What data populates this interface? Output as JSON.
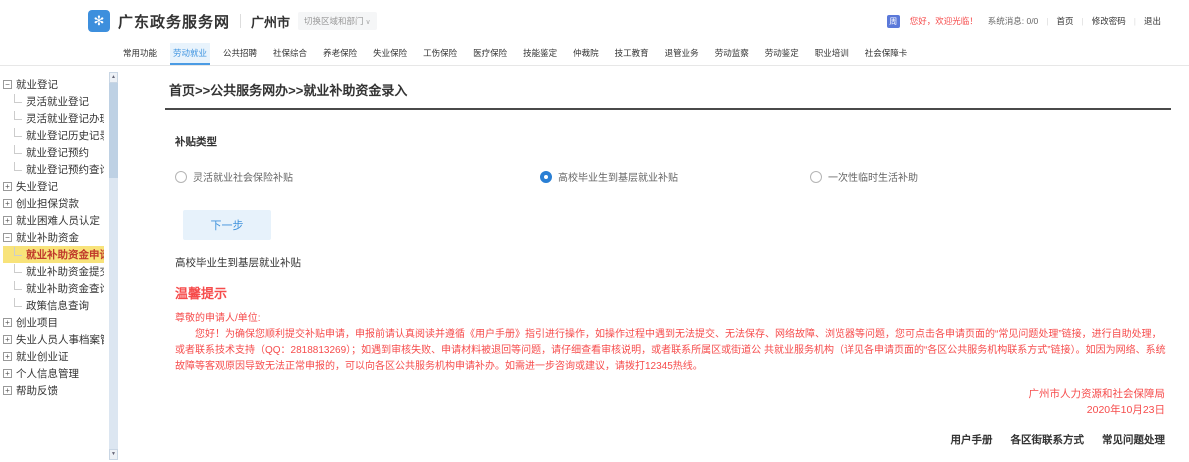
{
  "colors": {
    "accent_blue": "#3f94e0",
    "warning_red": "#f64c4c",
    "highlight_yellow": "#f8e37a",
    "selected_item_red": "#c0392b"
  },
  "header": {
    "site_title": "广东政务服务网",
    "city": "广州市",
    "region_switch": "切换区域和部门",
    "user_badge": "周",
    "welcome": "您好，欢迎光临！",
    "system_message": "系统消息: 0/0",
    "links": [
      "首页",
      "修改密码",
      "退出"
    ]
  },
  "nav": {
    "items": [
      {
        "label": "常用功能",
        "active": false
      },
      {
        "label": "劳动就业",
        "active": true
      },
      {
        "label": "公共招聘",
        "active": false
      },
      {
        "label": "社保综合",
        "active": false
      },
      {
        "label": "养老保险",
        "active": false
      },
      {
        "label": "失业保险",
        "active": false
      },
      {
        "label": "工伤保险",
        "active": false
      },
      {
        "label": "医疗保险",
        "active": false
      },
      {
        "label": "技能鉴定",
        "active": false
      },
      {
        "label": "仲裁院",
        "active": false
      },
      {
        "label": "技工教育",
        "active": false
      },
      {
        "label": "退管业务",
        "active": false
      },
      {
        "label": "劳动监察",
        "active": false
      },
      {
        "label": "劳动鉴定",
        "active": false
      },
      {
        "label": "职业培训",
        "active": false
      },
      {
        "label": "社会保障卡",
        "active": false
      }
    ]
  },
  "sidebar": {
    "items": [
      {
        "label": "就业登记",
        "level": 0,
        "expand": "minus",
        "selected": false
      },
      {
        "label": "灵活就业登记",
        "level": 1,
        "selected": false
      },
      {
        "label": "灵活就业登记办理结果",
        "level": 1,
        "selected": false
      },
      {
        "label": "就业登记历史记录",
        "level": 1,
        "selected": false
      },
      {
        "label": "就业登记预约",
        "level": 1,
        "selected": false
      },
      {
        "label": "就业登记预约查询",
        "level": 1,
        "selected": false
      },
      {
        "label": "失业登记",
        "level": 0,
        "expand": "plus",
        "selected": false
      },
      {
        "label": "创业担保贷款",
        "level": 0,
        "expand": "plus",
        "selected": false
      },
      {
        "label": "就业困难人员认定",
        "level": 0,
        "expand": "plus",
        "selected": false
      },
      {
        "label": "就业补助资金",
        "level": 0,
        "expand": "minus",
        "selected": false
      },
      {
        "label": "就业补助资金申请",
        "level": 1,
        "selected": true
      },
      {
        "label": "就业补助资金提交",
        "level": 1,
        "selected": false
      },
      {
        "label": "就业补助资金查询",
        "level": 1,
        "selected": false
      },
      {
        "label": "政策信息查询",
        "level": 1,
        "selected": false
      },
      {
        "label": "创业项目",
        "level": 0,
        "expand": "plus",
        "selected": false
      },
      {
        "label": "失业人员人事档案管理",
        "level": 0,
        "expand": "plus",
        "selected": false
      },
      {
        "label": "就业创业证",
        "level": 0,
        "expand": "plus",
        "selected": false
      },
      {
        "label": "个人信息管理",
        "level": 0,
        "expand": "plus",
        "selected": false
      },
      {
        "label": "帮助反馈",
        "level": 0,
        "expand": "plus",
        "selected": false
      }
    ]
  },
  "main": {
    "breadcrumb": "首页>>公共服务网办>>就业补助资金录入",
    "subsidy_type_label": "补贴类型",
    "radios": [
      {
        "label": "灵活就业社会保险补贴",
        "checked": false
      },
      {
        "label": "高校毕业生到基层就业补贴",
        "checked": true
      },
      {
        "label": "一次性临时生活补助",
        "checked": false
      }
    ],
    "next_button": "下一步",
    "selected_subsidy": "高校毕业生到基层就业补贴",
    "notice": {
      "title": "温馨提示",
      "salutation": "尊敬的申请人/单位:",
      "body": "您好！为确保您顺利提交补贴申请，申报前请认真阅读并遵循《用户手册》指引进行操作，如操作过程中遇到无法提交、无法保存、网络故障、浏览器等问题，您可点击各申请页面的“常见问题处理”链接，进行自助处理，或者联系技术支持（QQ：2818813269）；如遇到审核失败、申请材料被退回等问题，请仔细查看审核说明，或者联系所属区或街道公 共就业服务机构（详见各申请页面的“各区公共服务机构联系方式”链接）。如因为网络、系统故障等客观原因导致无法正常申报的，可以向各区公共服务机构申请补办。如需进一步咨询或建议，请拨打12345热线。",
      "agency": "广州市人力资源和社会保障局",
      "date": "2020年10月23日"
    },
    "footer_links": [
      "用户手册",
      "各区街联系方式",
      "常见问题处理"
    ]
  }
}
